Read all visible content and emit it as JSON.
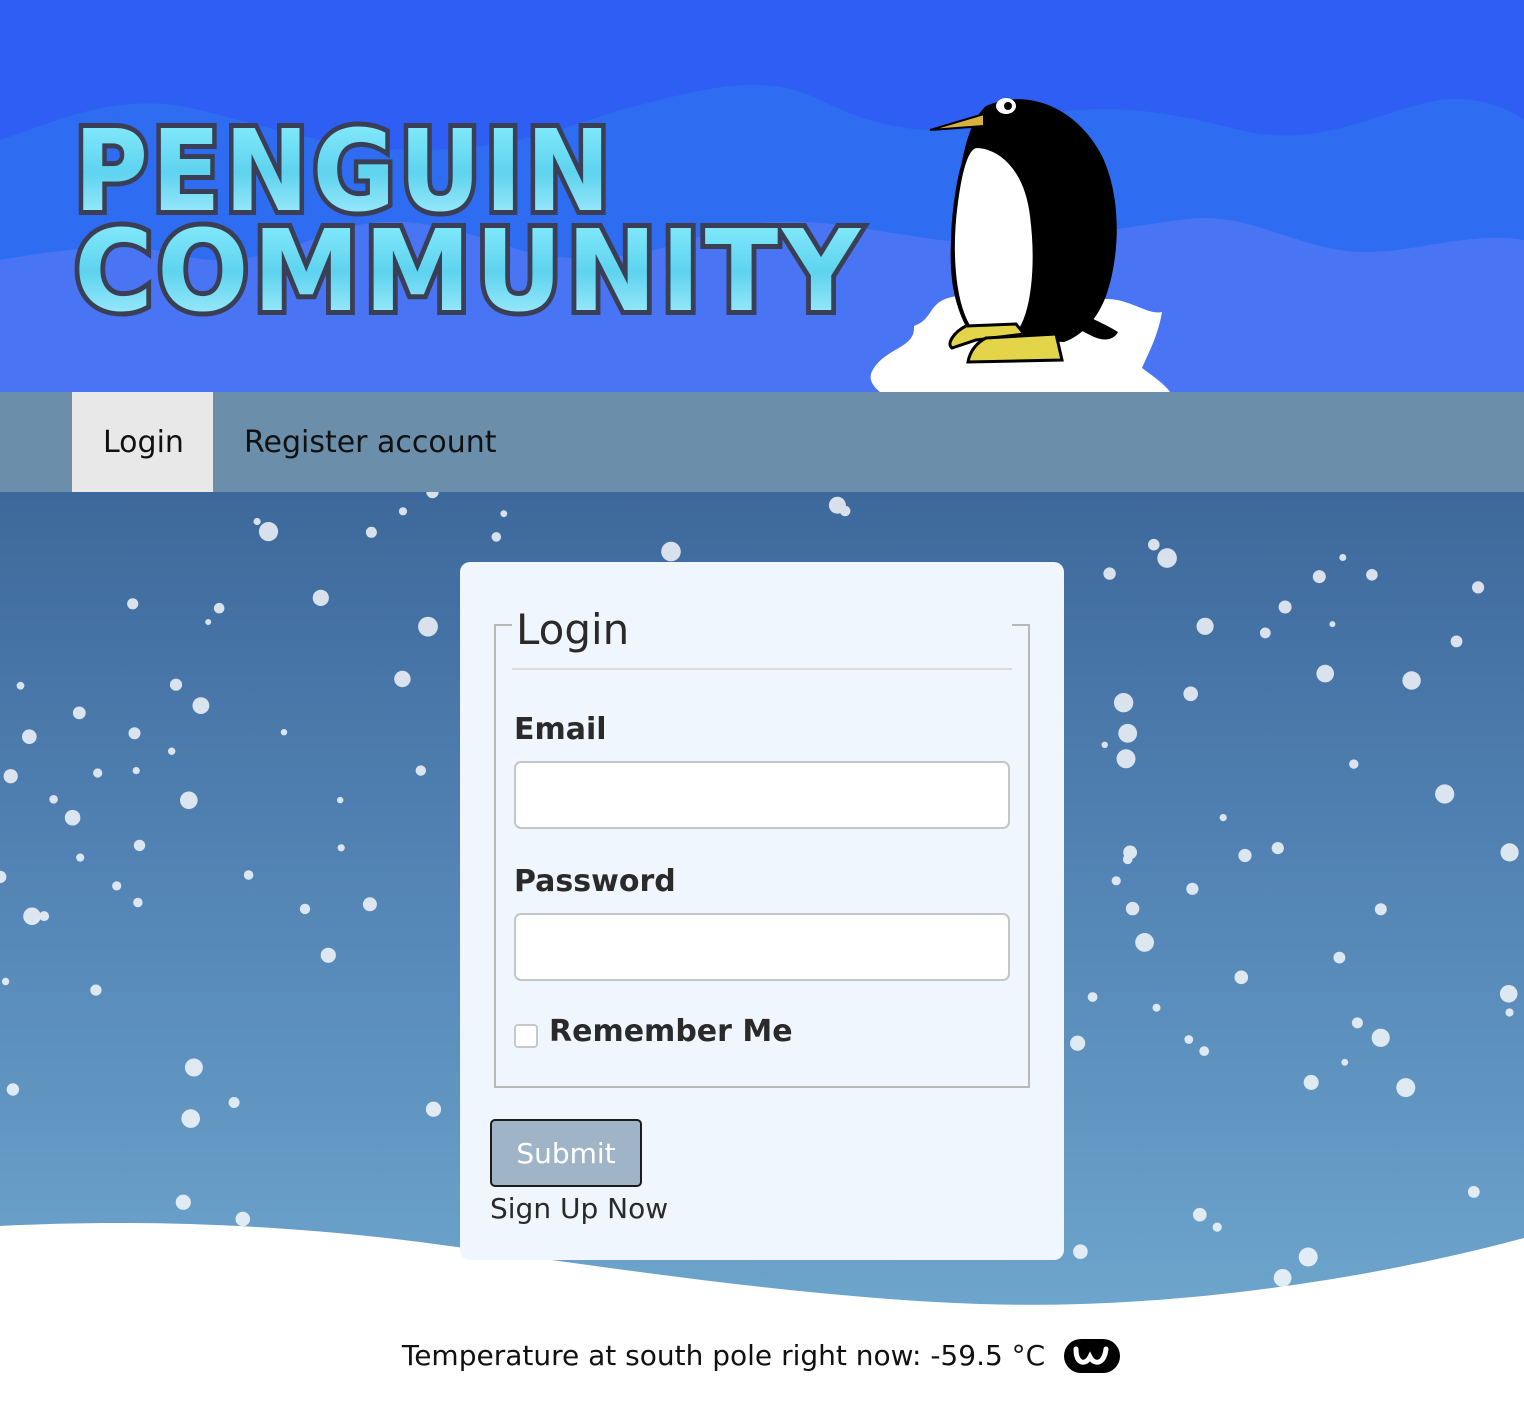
{
  "header": {
    "logo_line1": "PENGUIN",
    "logo_line2": "COMMUNITY",
    "mascot_icon": "penguin-on-ice-icon"
  },
  "nav": {
    "items": [
      {
        "label": "Login",
        "active": true
      },
      {
        "label": "Register account",
        "active": false
      }
    ]
  },
  "login_form": {
    "legend": "Login",
    "email_label": "Email",
    "email_value": "",
    "password_label": "Password",
    "password_value": "",
    "remember_label": "Remember Me",
    "remember_checked": false,
    "submit_label": "Submit",
    "signup_link": "Sign Up Now"
  },
  "footer": {
    "temperature_text": "Temperature at south pole right now: -59.5 °C",
    "weather_logo_icon": "weather-service-logo-icon"
  },
  "colors": {
    "banner_blue": "#2f5ef5",
    "nav_bg": "#6b8fab",
    "nav_active_bg": "#e8e8e8",
    "card_bg": "#eff6fd",
    "submit_bg": "#9fb5c7"
  }
}
